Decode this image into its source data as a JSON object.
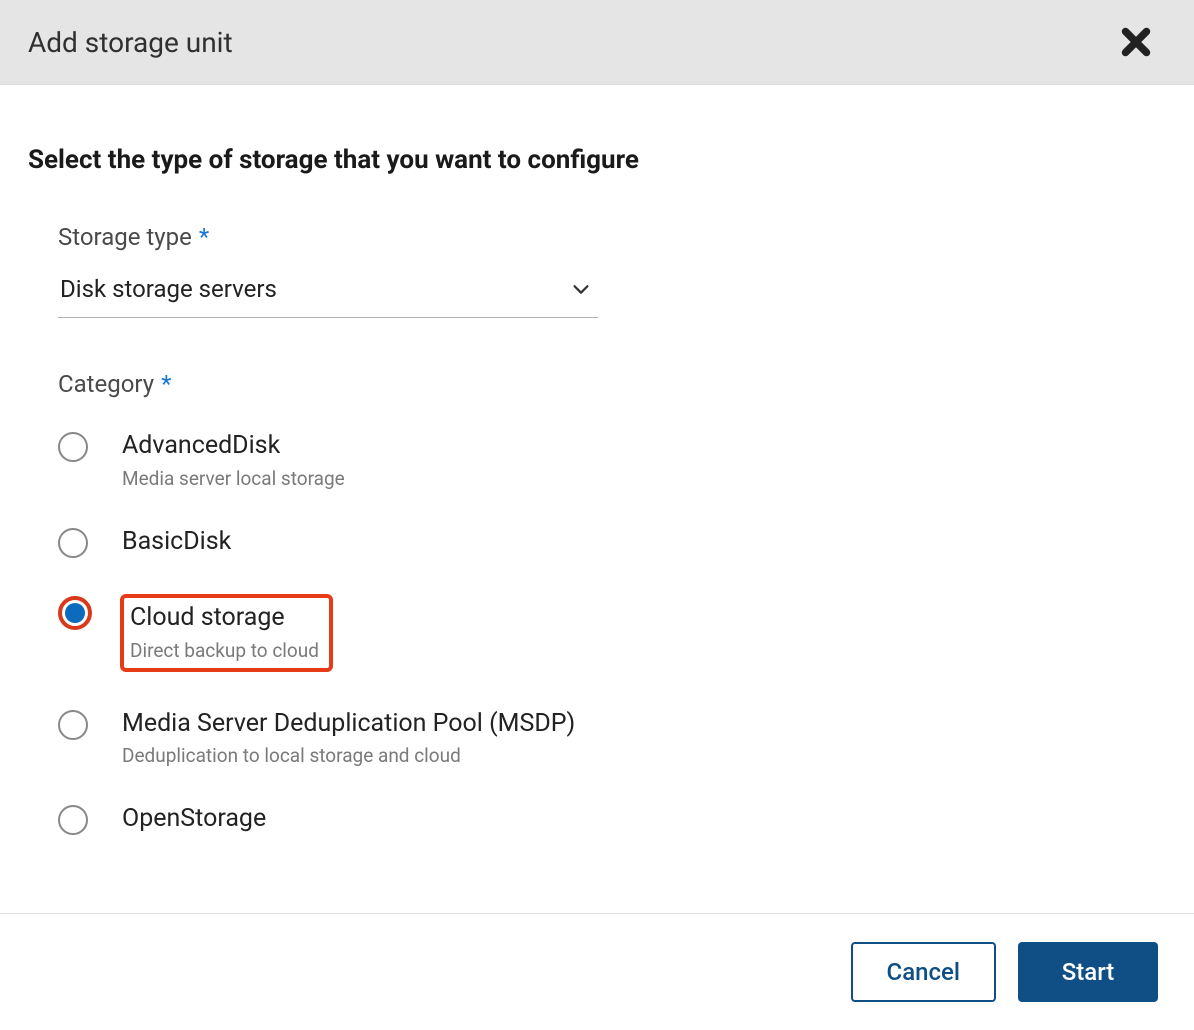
{
  "dialog": {
    "title": "Add storage unit",
    "heading": "Select the type of storage that you want to configure",
    "storage_type": {
      "label": "Storage type",
      "required_mark": "*",
      "value": "Disk storage servers"
    },
    "category": {
      "label": "Category",
      "required_mark": "*",
      "options": [
        {
          "title": "AdvancedDisk",
          "desc": "Media server local storage",
          "selected": false
        },
        {
          "title": "BasicDisk",
          "desc": "",
          "selected": false
        },
        {
          "title": "Cloud storage",
          "desc": "Direct backup to cloud",
          "selected": true,
          "highlighted": true
        },
        {
          "title": "Media Server Deduplication Pool (MSDP)",
          "desc": "Deduplication to local storage and cloud",
          "selected": false
        },
        {
          "title": "OpenStorage",
          "desc": "",
          "selected": false
        }
      ]
    },
    "footer": {
      "cancel": "Cancel",
      "start": "Start"
    }
  }
}
